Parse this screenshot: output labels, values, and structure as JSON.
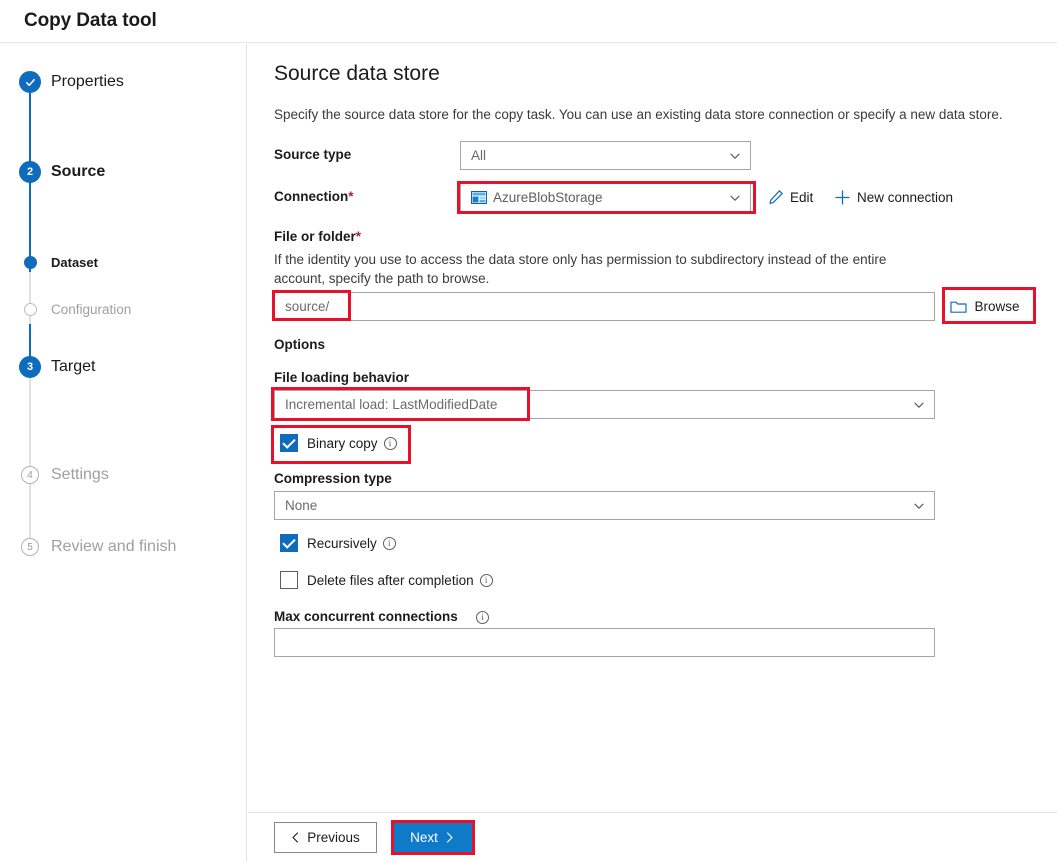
{
  "window": {
    "title": "Copy Data tool"
  },
  "wizard": {
    "steps": [
      {
        "id": "properties",
        "label": "Properties",
        "marker": "✓",
        "state": "complete",
        "level": 1
      },
      {
        "id": "source",
        "label": "Source",
        "marker": "2",
        "state": "current",
        "level": 1
      },
      {
        "id": "dataset",
        "label": "Dataset",
        "marker": "",
        "state": "active",
        "level": 2
      },
      {
        "id": "configuration",
        "label": "Configuration",
        "marker": "",
        "state": "disabled",
        "level": 2
      },
      {
        "id": "target",
        "label": "Target",
        "marker": "3",
        "state": "upcoming",
        "level": 1
      },
      {
        "id": "settings",
        "label": "Settings",
        "marker": "4",
        "state": "disabled",
        "level": 1
      },
      {
        "id": "review",
        "label": "Review and finish",
        "marker": "5",
        "state": "disabled",
        "level": 1
      }
    ]
  },
  "page": {
    "title": "Source data store",
    "description": "Specify the source data store for the copy task. You can use an existing data store connection or specify a new data store."
  },
  "form": {
    "source_type": {
      "label": "Source type",
      "value": "All"
    },
    "connection": {
      "label": "Connection",
      "required_mark": "*",
      "value": "AzureBlobStorage",
      "icon": "azure-blob-storage-icon",
      "edit_label": "Edit",
      "edit_icon": "pencil-icon",
      "new_connection_label": "New connection",
      "new_connection_icon": "plus-icon"
    },
    "file_or_folder": {
      "label": "File or folder",
      "required_mark": "*",
      "helper": "If the identity you use to access the data store only has permission to subdirectory instead of the entire account, specify the path to browse.",
      "value": "source/",
      "browse_label": "Browse",
      "browse_icon": "folder-icon"
    },
    "options": {
      "heading": "Options",
      "file_loading_behavior": {
        "label": "File loading behavior",
        "value": "Incremental load: LastModifiedDate"
      },
      "binary_copy": {
        "label": "Binary copy",
        "checked": true,
        "info_icon": "info-icon"
      },
      "compression_type": {
        "label": "Compression type",
        "value": "None"
      },
      "recursively": {
        "label": "Recursively",
        "checked": true,
        "info_icon": "info-icon"
      },
      "delete_files": {
        "label": "Delete files after completion",
        "checked": false,
        "info_icon": "info-icon"
      },
      "max_concurrent_connections": {
        "label": "Max concurrent connections",
        "value": "",
        "info_icon": "info-icon"
      }
    }
  },
  "footer": {
    "previous_label": "Previous",
    "next_label": "Next"
  },
  "colors": {
    "accent_blue": "#0f6cbd",
    "primary_button": "#0f7ac8",
    "highlight_red": "#e8112b",
    "required_red": "#a4262c",
    "disabled_gray": "#a19f9d"
  }
}
